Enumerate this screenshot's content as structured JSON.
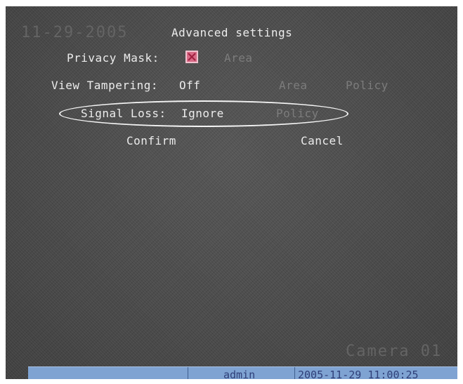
{
  "overlay": {
    "date_ghost": "11-29-2005",
    "camera_ghost": "Camera 01"
  },
  "dialog": {
    "title": "Advanced settings",
    "privacy_mask": {
      "label": "Privacy Mask:",
      "checked": true,
      "area_button": "Area"
    },
    "view_tampering": {
      "label": "View Tampering:",
      "value": "Off",
      "area_button": "Area",
      "policy_button": "Policy"
    },
    "signal_loss": {
      "label": "Signal Loss:",
      "value": "Ignore",
      "policy_button": "Policy",
      "highlighted": true
    },
    "confirm_button": "Confirm",
    "cancel_button": "Cancel"
  },
  "status_bar": {
    "user": "admin",
    "datetime": "2005-11-29 11:00:25"
  },
  "colors": {
    "osd_text": "#ececec",
    "disabled_text": "#7c7c7c",
    "checkbox": "#d86a86",
    "status_bar": "#7fa3d2",
    "status_text": "#2f3f78"
  }
}
